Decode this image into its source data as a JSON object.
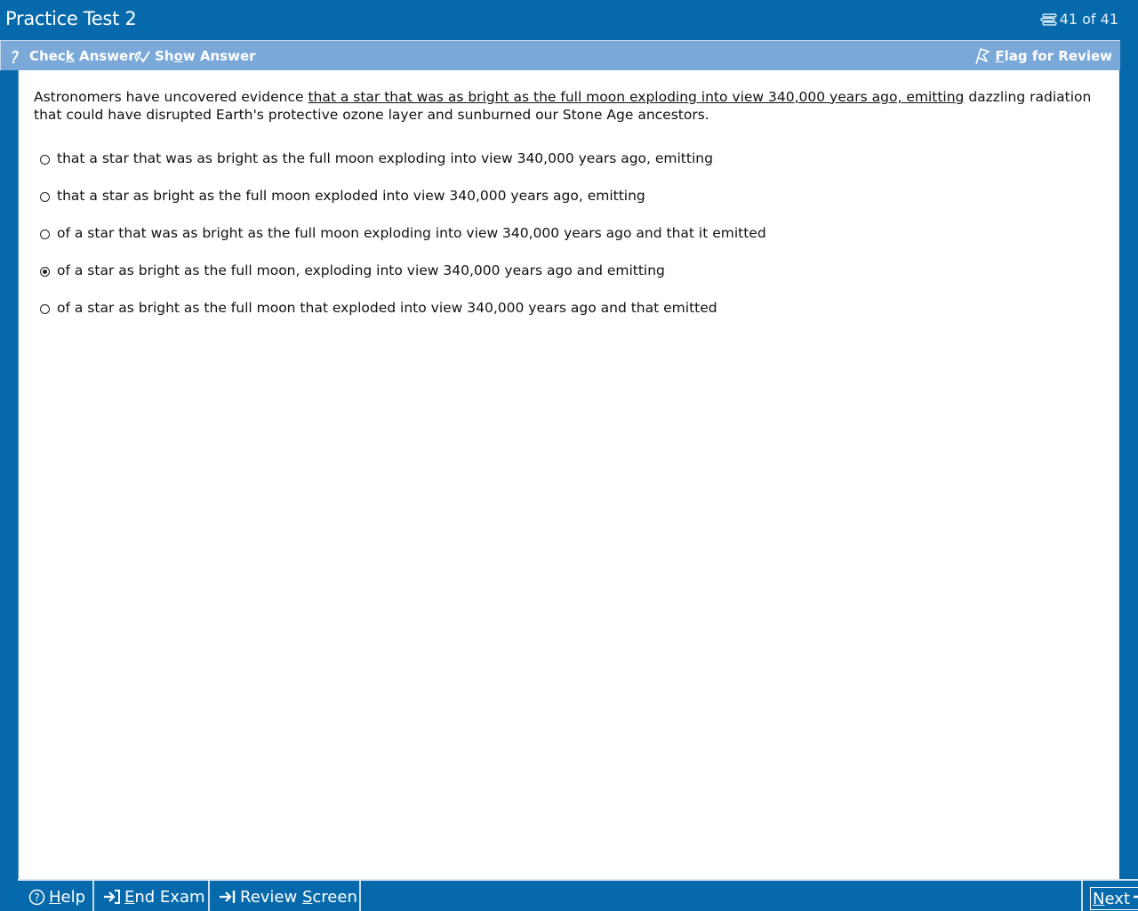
{
  "titlebar": {
    "title": "Practice Test 2",
    "progress": "41 of 41",
    "progress_icon": "list-icon"
  },
  "toolbar": {
    "check_answer_pre": "Chec",
    "check_answer_key": "k",
    "check_answer_post": " Answer",
    "show_answer_pre": "Sh",
    "show_answer_key": "o",
    "show_answer_post": "w Answer",
    "flag_key": "F",
    "flag_post": "lag for Review"
  },
  "question": {
    "stem_before": "Astronomers have uncovered evidence ",
    "stem_underlined": "that a star that was as bright as the full moon exploding into view 340,000 years ago, emitting",
    "stem_after": " dazzling radiation that could have disrupted Earth's protective ozone layer and sunburned our Stone Age ancestors.",
    "choices": [
      {
        "text": "that a star that was as bright as the full moon exploding into view 340,000 years ago, emitting",
        "selected": false
      },
      {
        "text": "that a star as bright as the full moon exploded into view 340,000 years ago, emitting",
        "selected": false
      },
      {
        "text": "of a star that was as bright as the full moon exploding into view 340,000 years ago and that it emitted",
        "selected": false
      },
      {
        "text": "of a star as bright as the full moon, exploding into view 340,000 years ago and emitting",
        "selected": true
      },
      {
        "text": "of a star as bright as the full moon that exploded into view 340,000 years ago and that emitted",
        "selected": false
      }
    ]
  },
  "bottombar": {
    "help_key": "H",
    "help_post": "elp",
    "end_exam_key": "E",
    "end_exam_post": "nd Exam",
    "review_pre": "Review ",
    "review_key": "S",
    "review_post": "creen",
    "next_key": "N",
    "next_post": "ext"
  }
}
